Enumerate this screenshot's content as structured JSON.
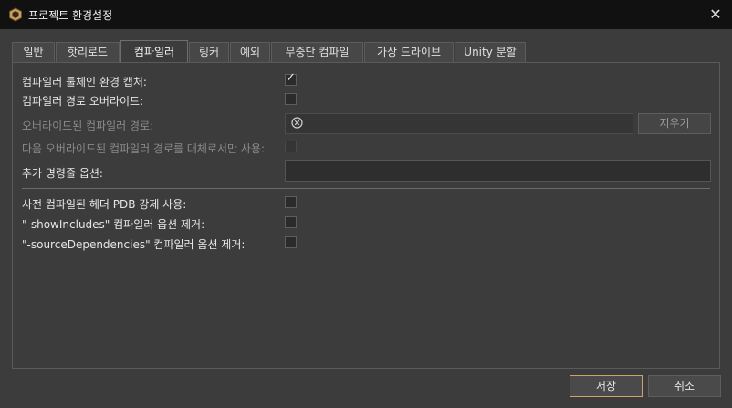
{
  "window": {
    "title": "프로젝트 환경설정",
    "close_icon": "close-icon"
  },
  "tabs": [
    {
      "label": "일반"
    },
    {
      "label": "핫리로드"
    },
    {
      "label": "컴파일러",
      "active": true
    },
    {
      "label": "링커"
    },
    {
      "label": "예외"
    },
    {
      "label": "무중단 컴파일"
    },
    {
      "label": "가상 드라이브"
    },
    {
      "label": "Unity 분할"
    }
  ],
  "compiler": {
    "capture_env": {
      "label": "컴파일러 툴체인 환경 캡처:",
      "checked": true
    },
    "override_path": {
      "label": "컴파일러 경로 오버라이드:",
      "checked": false
    },
    "overridden_path": {
      "label": "오버라이드된 컴파일러 경로:",
      "value": "",
      "clear_label": "지우기"
    },
    "only_replace": {
      "label": "다음 오버라이드된 컴파일러 경로를 대체로서만 사용:",
      "checked": false
    },
    "extra_cmdline": {
      "label": "추가 명령줄 옵션:",
      "value": ""
    },
    "force_pdb": {
      "label": "사전 컴파일된 헤더 PDB 강제 사용:",
      "checked": false
    },
    "remove_showincludes": {
      "label": "\"-showIncludes\" 컴파일러 옵션 제거:",
      "checked": false
    },
    "remove_sourcedeps": {
      "label": "\"-sourceDependencies\" 컴파일러 옵션 제거:",
      "checked": false
    }
  },
  "footer": {
    "save_label": "저장",
    "cancel_label": "취소"
  },
  "colors": {
    "background": "#3c3c3c",
    "titlebar": "#111111",
    "accent_border": "#c8a46a"
  }
}
